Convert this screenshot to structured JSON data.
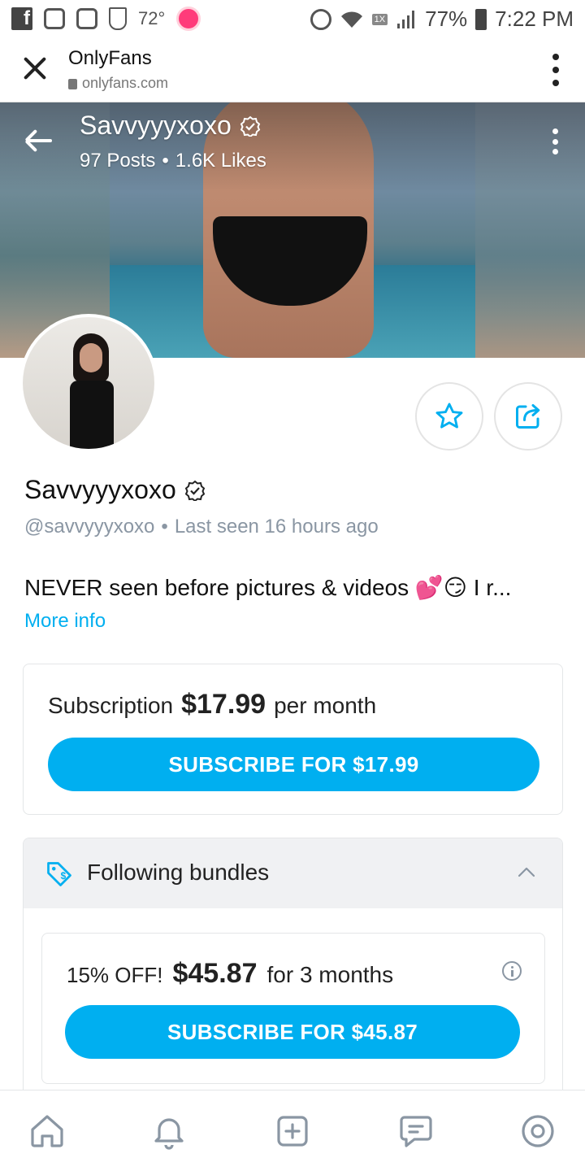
{
  "status_bar": {
    "temperature": "72°",
    "signal_tag": "1X",
    "battery": "77%",
    "time": "7:22 PM"
  },
  "browser": {
    "title": "OnlyFans",
    "url": "onlyfans.com"
  },
  "cover": {
    "name": "Savvyyyxoxo",
    "posts": "97 Posts",
    "separator": "•",
    "likes": "1.6K Likes"
  },
  "profile": {
    "name": "Savvyyyxoxo",
    "handle": "@savvyyyxoxo",
    "separator": "•",
    "last_seen": "Last seen 16 hours ago",
    "bio": "NEVER seen before pictures & videos 💕😏 I r...",
    "more_info": "More info"
  },
  "subscription": {
    "label": "Subscription",
    "price": "$17.99",
    "period": "per month",
    "button": "SUBSCRIBE FOR $17.99"
  },
  "bundles": {
    "title": "Following bundles",
    "offer": {
      "discount": "15% OFF!",
      "price": "$45.87",
      "period": "for 3 months",
      "button": "SUBSCRIBE FOR $45.87"
    }
  },
  "colors": {
    "accent": "#00aff0",
    "muted": "#8a96a3"
  },
  "icons": {
    "nav": [
      "home-icon",
      "bell-icon",
      "plus-square-icon",
      "message-icon",
      "profile-icon"
    ]
  }
}
